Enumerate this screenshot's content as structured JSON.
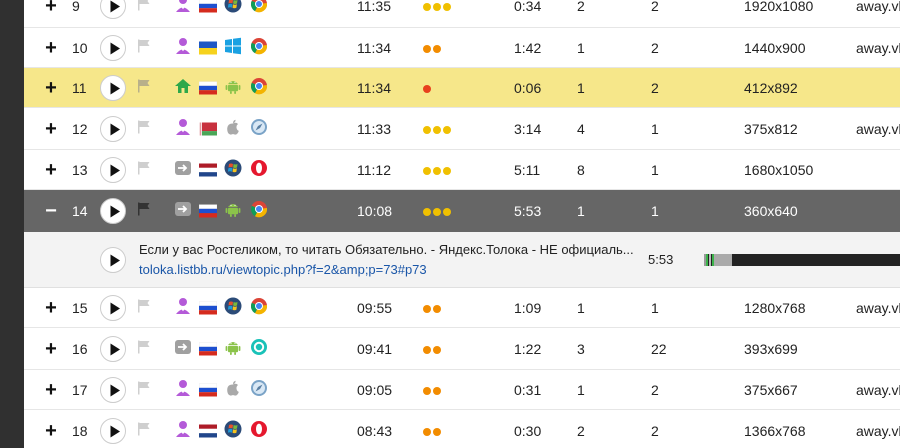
{
  "rows": [
    {
      "expand": "+",
      "num": "9",
      "flag": "#cfcfcf",
      "icons": [
        "person-icon",
        "ru-flag",
        "windows7-icon",
        "chrome-icon"
      ],
      "time": "11:35",
      "dots": [
        "#f0c000",
        "#f0c000",
        "#f0c000"
      ],
      "duration": "0:34",
      "pageviews": "2",
      "depth": "2",
      "resolution": "1920x1080",
      "referrer": "away.vk"
    },
    {
      "expand": "+",
      "num": "10",
      "flag": "#cfcfcf",
      "icons": [
        "person-icon",
        "ua-flag",
        "windows10-icon",
        "chrome-icon"
      ],
      "time": "11:34",
      "dots": [
        "#f28c00",
        "#f28c00"
      ],
      "duration": "1:42",
      "pageviews": "1",
      "depth": "2",
      "resolution": "1440x900",
      "referrer": "away.vk"
    },
    {
      "expand": "+",
      "num": "11",
      "flag": "#b8b08a",
      "icons": [
        "home-icon",
        "ru-flag",
        "android-icon",
        "chrome-icon"
      ],
      "time": "11:34",
      "dots": [
        "#e8401c"
      ],
      "duration": "0:06",
      "pageviews": "1",
      "depth": "2",
      "resolution": "412x892",
      "referrer": ""
    },
    {
      "expand": "+",
      "num": "12",
      "flag": "#cfcfcf",
      "icons": [
        "person-icon",
        "by-flag",
        "apple-icon",
        "safari-icon"
      ],
      "time": "11:33",
      "dots": [
        "#f0c000",
        "#f0c000",
        "#f0c000"
      ],
      "duration": "3:14",
      "pageviews": "4",
      "depth": "1",
      "resolution": "375x812",
      "referrer": "away.vk"
    },
    {
      "expand": "+",
      "num": "13",
      "flag": "#cfcfcf",
      "icons": [
        "arrow-icon",
        "nl-flag",
        "windows7-icon",
        "opera-icon"
      ],
      "time": "11:12",
      "dots": [
        "#f0c000",
        "#f0c000",
        "#f0c000"
      ],
      "duration": "5:11",
      "pageviews": "8",
      "depth": "1",
      "resolution": "1680x1050",
      "referrer": ""
    },
    {
      "expand": "−",
      "num": "14",
      "flag": "#333333",
      "icons": [
        "arrow-icon",
        "ru-flag",
        "android-icon",
        "chrome-icon"
      ],
      "time": "10:08",
      "dots": [
        "#f0c000",
        "#f0c000",
        "#f0c000"
      ],
      "duration": "5:53",
      "pageviews": "1",
      "depth": "1",
      "resolution": "360x640",
      "referrer": ""
    },
    {
      "expand": "+",
      "num": "15",
      "flag": "#cfcfcf",
      "icons": [
        "person-icon",
        "ru-flag",
        "windows7-icon",
        "chrome-icon"
      ],
      "time": "09:55",
      "dots": [
        "#f28c00",
        "#f28c00"
      ],
      "duration": "1:09",
      "pageviews": "1",
      "depth": "1",
      "resolution": "1280x768",
      "referrer": "away.vk"
    },
    {
      "expand": "+",
      "num": "16",
      "flag": "#cfcfcf",
      "icons": [
        "arrow-icon",
        "ru-flag",
        "android-icon",
        "browser-circle-icon"
      ],
      "time": "09:41",
      "dots": [
        "#f28c00",
        "#f28c00"
      ],
      "duration": "1:22",
      "pageviews": "3",
      "depth": "22",
      "resolution": "393x699",
      "referrer": ""
    },
    {
      "expand": "+",
      "num": "17",
      "flag": "#cfcfcf",
      "icons": [
        "person-icon",
        "ru-flag",
        "apple-icon",
        "safari-icon"
      ],
      "time": "09:05",
      "dots": [
        "#f28c00",
        "#f28c00"
      ],
      "duration": "0:31",
      "pageviews": "1",
      "depth": "2",
      "resolution": "375x667",
      "referrer": "away.vk"
    },
    {
      "expand": "+",
      "num": "18",
      "flag": "#cfcfcf",
      "icons": [
        "person-icon",
        "nl-flag",
        "windows7-icon",
        "opera-icon"
      ],
      "time": "08:43",
      "dots": [
        "#f28c00",
        "#f28c00"
      ],
      "duration": "0:30",
      "pageviews": "2",
      "depth": "2",
      "resolution": "1366x768",
      "referrer": "away.vk"
    }
  ],
  "detail": {
    "title": "Если у вас Ростеликом, то читать Обязательно. - Яндекс.Толока - НЕ официаль...",
    "url": "toloka.ru.listbb.ru/viewtopic.php?f=2&amp;p=73#p73",
    "url_display": "toloka.listbb.ru/viewtopic.php?f=2&amp;p=73#p73",
    "duration": "5:53"
  }
}
